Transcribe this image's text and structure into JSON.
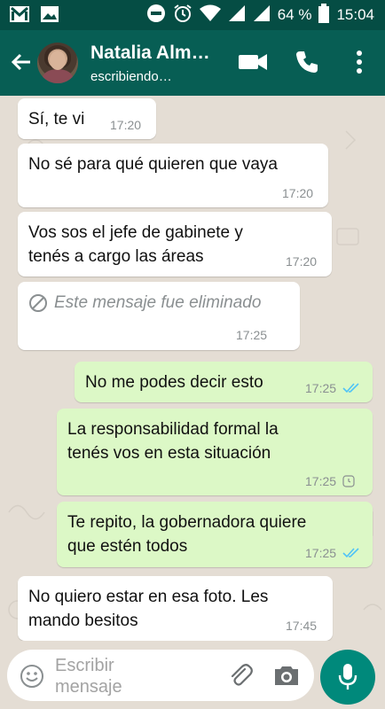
{
  "status_bar": {
    "battery_percent": "64 %",
    "time": "15:04",
    "icons": [
      "gmail-icon",
      "gallery-icon",
      "dnd-icon",
      "alarm-icon",
      "wifi-icon",
      "signal-icon",
      "signal-icon",
      "battery-icon"
    ]
  },
  "header": {
    "contact_name": "Natalia Alm…",
    "contact_status": "escribiendo…",
    "icons": [
      "back-arrow-icon",
      "video-call-icon",
      "phone-icon",
      "more-vert-icon"
    ]
  },
  "messages": [
    {
      "direction": "in",
      "lines": [
        "Sí, te vi"
      ],
      "time": "17:20"
    },
    {
      "direction": "in",
      "lines": [
        "No sé para qué quieren que vaya"
      ],
      "time": "17:20"
    },
    {
      "direction": "in",
      "lines": [
        "Vos sos el jefe de gabinete y",
        "tenés a cargo las áreas"
      ],
      "time": "17:20"
    },
    {
      "direction": "in",
      "deleted": true,
      "lines": [
        "Este mensaje fue eliminado"
      ],
      "time": "17:25"
    },
    {
      "direction": "out",
      "lines": [
        "No me podes decir esto"
      ],
      "time": "17:25",
      "status": "read"
    },
    {
      "direction": "out",
      "lines": [
        "La responsabilidad formal la",
        "tenés vos en esta situación"
      ],
      "time": "17:25",
      "status": "pending"
    },
    {
      "direction": "out",
      "lines": [
        "Te repito, la gobernadora quiere",
        "que estén todos"
      ],
      "time": "17:25",
      "status": "read"
    },
    {
      "direction": "in",
      "lines": [
        "No quiero estar en esa foto. Les",
        "mando besitos"
      ],
      "time": "17:45"
    }
  ],
  "composer": {
    "placeholder_line1": "Escribir",
    "placeholder_line2": "mensaje",
    "icons": [
      "emoji-icon",
      "attach-icon",
      "camera-icon",
      "mic-icon"
    ]
  },
  "colors": {
    "header": "#075e54",
    "status_bar": "#054d44",
    "outgoing_bubble": "#dcf8c6",
    "incoming_bubble": "#ffffff",
    "read_ticks": "#4fc3f7",
    "mic_button": "#00897b",
    "chat_background": "#e4ddd4"
  }
}
